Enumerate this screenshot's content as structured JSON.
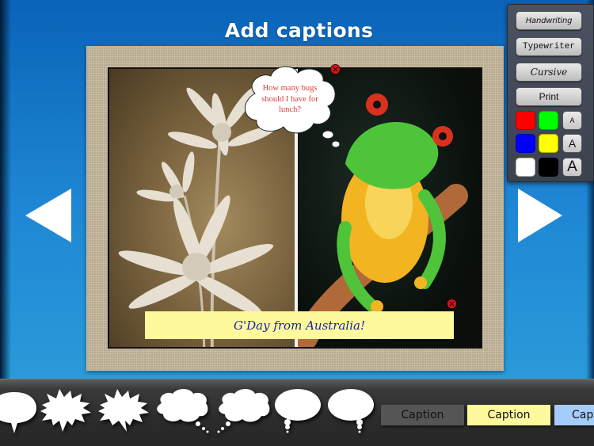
{
  "header": {
    "title": "Add captions"
  },
  "navigation": {
    "previous_icon": "triangle-left-icon",
    "next_icon": "triangle-right-icon"
  },
  "canvas": {
    "thought_bubble": {
      "text_lines": [
        "How many bugs",
        "should I have for",
        "lunch?"
      ],
      "text_color": "#e23b3b"
    },
    "caption": {
      "text": "G'Day from Australia!",
      "background": "#fdf99c",
      "text_color": "#1f22a8"
    },
    "delete_icon": "delete-x-icon"
  },
  "style_panel": {
    "fonts": [
      {
        "label": "Handwriting"
      },
      {
        "label": "Typewriter"
      },
      {
        "label": "Cursive"
      },
      {
        "label": "Print"
      }
    ],
    "colors": [
      {
        "name": "red",
        "hex": "#ff0000"
      },
      {
        "name": "green",
        "hex": "#00ff00"
      },
      {
        "name": "blue",
        "hex": "#0000ff"
      },
      {
        "name": "yellow",
        "hex": "#ffff00"
      },
      {
        "name": "white",
        "hex": "#ffffff"
      },
      {
        "name": "black",
        "hex": "#000000"
      }
    ],
    "sizes": [
      {
        "name": "small",
        "label": "A"
      },
      {
        "name": "medium",
        "label": "A"
      },
      {
        "name": "large",
        "label": "A"
      }
    ]
  },
  "tray": {
    "bubbles": [
      {
        "type": "speech-oval"
      },
      {
        "type": "shout-burst"
      },
      {
        "type": "shout-burst"
      },
      {
        "type": "thought-cloud"
      },
      {
        "type": "thought-cloud"
      },
      {
        "type": "speech-oval-small-tail"
      },
      {
        "type": "speech-oval-small-tail"
      }
    ],
    "captions": [
      {
        "label": "Caption",
        "background": "#555555"
      },
      {
        "label": "Caption",
        "background": "#fdf99c"
      },
      {
        "label": "Caption",
        "background": "#a6cdfa"
      }
    ]
  }
}
